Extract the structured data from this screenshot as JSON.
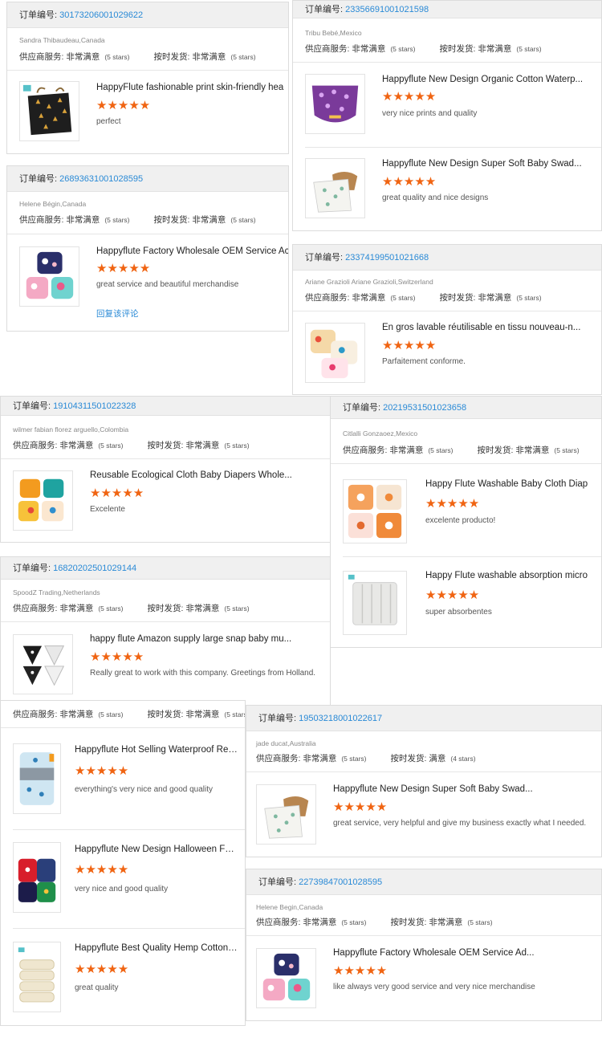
{
  "labels": {
    "order_prefix": "订单编号: ",
    "supplier": "供应商服务: ",
    "shipping": "按时发货: ",
    "very_satisfied": "非常满意",
    "satisfied": "满意",
    "five_stars": "(5 stars)",
    "four_stars": "(4 stars)",
    "stars_glyphs": "★★★★★"
  },
  "colors": {
    "star": "#f06412",
    "link": "#2a8ad6",
    "header_bg": "#f0f0f0"
  },
  "reviews": {
    "c1": {
      "order_no": "30173206001029622",
      "buyer": "Sandra Thibaudeau,Canada",
      "product": "HappyFlute fashionable print skin-friendly hea",
      "comment": "perfect"
    },
    "c2": {
      "order_no": "26893631001028595",
      "buyer": "Helene Bégin,Canada",
      "product": "Happyflute Factory Wholesale OEM Service Ac",
      "comment": "great service and beautiful merchandise",
      "reply": "回复该评论"
    },
    "c3": {
      "order_no": "23356691001021598",
      "buyer": "Tribu Bebé,Mexico",
      "items": [
        {
          "product": "Happyflute New Design Organic Cotton Waterp...",
          "comment": "very nice prints and quality"
        },
        {
          "product": "Happyflute New Design Super Soft Baby Swad...",
          "comment": "great quality and nice designs"
        }
      ]
    },
    "c4": {
      "order_no": "23374199501021668",
      "buyer": "Ariane Grazioli Ariane Grazioli,Switzerland",
      "product": "En gros lavable réutilisable en tissu nouveau-n...",
      "comment": "Parfaitement conforme."
    },
    "c5": {
      "order_no": "19104311501022328",
      "buyer": "wilmer fabian florez arguello,Colombia",
      "product": "Reusable Ecological Cloth Baby Diapers Whole...",
      "comment": "Excelente"
    },
    "c6": {
      "order_no": "20219531501023658",
      "buyer": "Citlalli Gonzaoez,Mexico",
      "items": [
        {
          "product": "Happy Flute Washable Baby Cloth Diap",
          "comment": "excelente producto!"
        },
        {
          "product": "Happy Flute washable absorption micro",
          "comment": "super absorbentes"
        }
      ]
    },
    "c7": {
      "order_no": "16820202501029144",
      "buyer": "SpoodZ Trading,Netherlands",
      "product": "happy flute Amazon supply large snap baby mu...",
      "comment": "Really great to work with this company. Greetings from Holland."
    },
    "c8": {
      "items": [
        {
          "product": "Happyflute Hot Selling Waterproof Reusable A...",
          "comment": "everything's very nice and good quality"
        },
        {
          "product": "Happyflute New Design Halloween Fashion Ba...",
          "comment": "very nice and good quality"
        },
        {
          "product": "Happyflute Best Quality Hemp Cotton Baby Dia...",
          "comment": "great quality"
        }
      ]
    },
    "c9": {
      "order_no": "19503218001022617",
      "buyer": "jade ducat,Australia",
      "product": "Happyflute New Design Super Soft Baby Swad...",
      "comment": "great service, very helpful and give my business exactly what I needed."
    },
    "c10": {
      "order_no": "22739847001028595",
      "buyer": "Helene Begin,Canada",
      "product": "Happyflute Factory Wholesale OEM Service Ad...",
      "comment": "like always very good service and very nice merchandise"
    }
  }
}
